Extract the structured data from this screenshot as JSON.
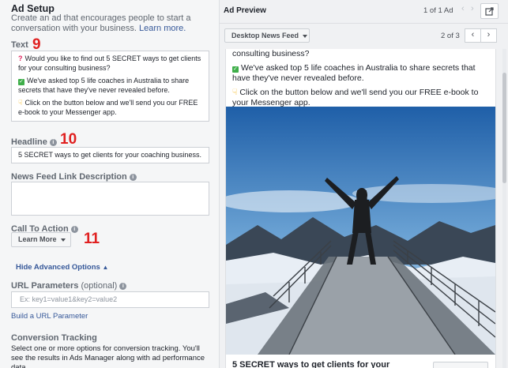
{
  "setup": {
    "title": "Ad Setup",
    "subtitle": "Create an ad that encourages people to start a conversation with your business.",
    "learn_more": "Learn more."
  },
  "fields": {
    "text_label": "Text",
    "text_step": "9",
    "text_lines": [
      "Would you like to find out 5 SECRET ways to get clients for your consulting business?",
      "We've asked top 5 life coaches in Australia to share secrets that have they've never revealed before.",
      "Click on the button below and we'll send you our FREE e-book to your Messenger app."
    ],
    "headline_label": "Headline",
    "headline_step": "10",
    "headline_value": "5 SECRET ways to get clients for your coaching business.",
    "newsfeed_desc_label": "News Feed Link Description",
    "cta_label": "Call To Action",
    "cta_step": "11",
    "cta_value": "Learn More",
    "advanced_toggle": "Hide Advanced Options",
    "url_params_label": "URL Parameters",
    "url_params_optional": "(optional)",
    "url_params_placeholder": "Ex: key1=value1&key2=value2",
    "build_url_link": "Build a URL Parameter",
    "conversion_label": "Conversion Tracking",
    "conversion_desc": "Select one or more options for conversion tracking. You'll see the results in Ads Manager along with ad performance data."
  },
  "preview": {
    "title": "Ad Preview",
    "ad_count": "1 of 1 Ad",
    "placement": "Desktop News Feed",
    "page_of": "2 of 3",
    "post_lines": [
      "consulting business?",
      "We've asked top 5 life coaches in Australia to share secrets that have they've never revealed before.",
      "Click on the button below and we'll send you our FREE e-book to your Messenger app."
    ],
    "headline": "5 SECRET ways to get clients for your"
  },
  "colors": {
    "link": "#365899",
    "step_number": "#e02020",
    "panel_bg": "#f5f6f7"
  }
}
